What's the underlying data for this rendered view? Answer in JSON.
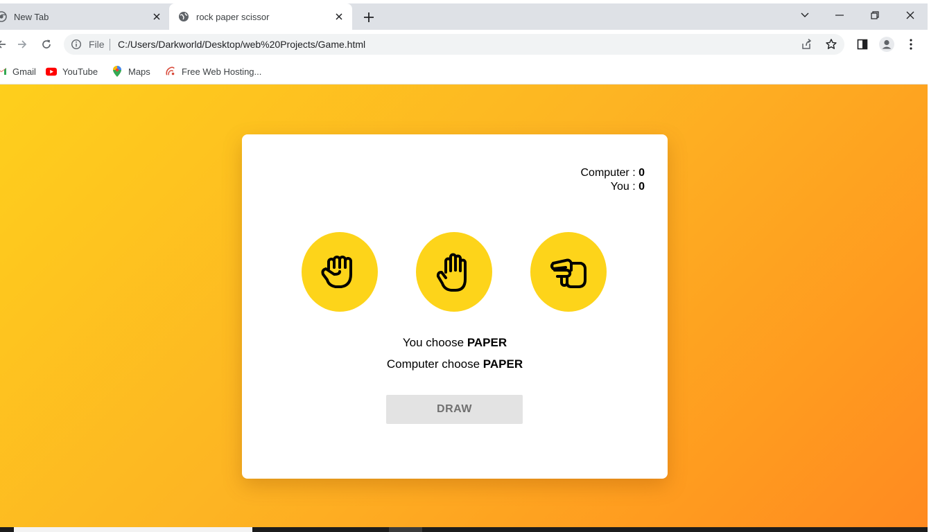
{
  "browser": {
    "tabs": [
      {
        "title": "New Tab",
        "active": false
      },
      {
        "title": "rock paper scissor",
        "active": true
      }
    ],
    "address": {
      "scheme_label": "File",
      "url": "C:/Users/Darkworld/Desktop/web%20Projects/Game.html"
    },
    "bookmarks": [
      {
        "label": "Gmail",
        "icon": "gmail-icon"
      },
      {
        "label": "YouTube",
        "icon": "youtube-icon"
      },
      {
        "label": "Maps",
        "icon": "maps-icon"
      },
      {
        "label": "Free Web Hosting...",
        "icon": "hosting-icon"
      }
    ]
  },
  "game": {
    "score": {
      "computer_label": "Computer : ",
      "computer_value": "0",
      "you_label": "You : ",
      "you_value": "0"
    },
    "choices": [
      {
        "name": "rock",
        "icon": "fist-icon"
      },
      {
        "name": "paper",
        "icon": "open-hand-icon"
      },
      {
        "name": "scissor",
        "icon": "scissor-hand-icon"
      }
    ],
    "you_choose_label": "You choose ",
    "you_choice": "PAPER",
    "computer_choose_label": "Computer choose ",
    "computer_choice": "PAPER",
    "result": "DRAW"
  },
  "colors": {
    "choice_circle": "#fdd41a",
    "background_start": "#fecf1c",
    "background_end": "#ff8a20",
    "result_button_bg": "#e3e3e3",
    "result_button_text": "#707070"
  }
}
